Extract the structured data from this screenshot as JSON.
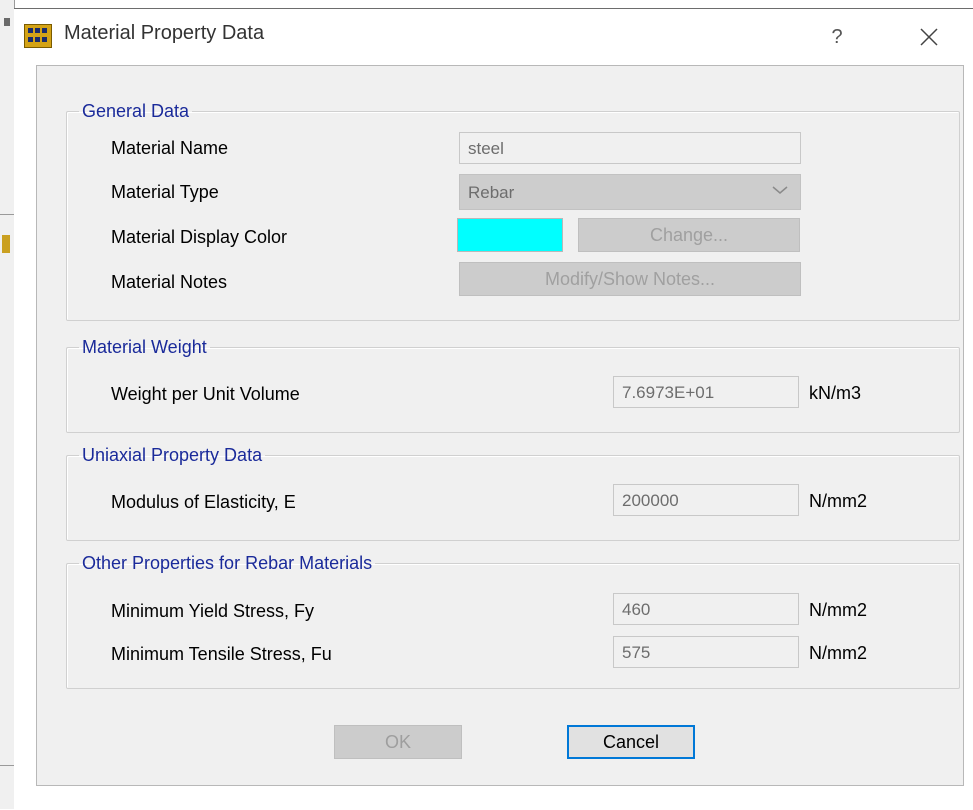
{
  "window": {
    "title": "Material Property Data",
    "help_label": "?",
    "icons": {
      "app": "etabs-app-icon",
      "close": "close-icon"
    }
  },
  "general": {
    "legend": "General Data",
    "name_label": "Material Name",
    "name_value": "steel",
    "type_label": "Material Type",
    "type_value": "Rebar",
    "color_label": "Material Display Color",
    "color_value": "#00ffff",
    "change_label": "Change...",
    "notes_label": "Material Notes",
    "notes_button": "Modify/Show Notes..."
  },
  "weight": {
    "legend": "Material Weight",
    "label": "Weight per Unit Volume",
    "value": "7.6973E+01",
    "unit": "kN/m3"
  },
  "uniaxial": {
    "legend": "Uniaxial Property Data",
    "label": "Modulus of Elasticity,  E",
    "value": "200000",
    "unit": "N/mm2"
  },
  "rebar": {
    "legend": "Other Properties for Rebar Materials",
    "fy_label": "Minimum Yield Stress, Fy",
    "fy_value": "460",
    "fy_unit": "N/mm2",
    "fu_label": "Minimum Tensile Stress, Fu",
    "fu_value": "575",
    "fu_unit": "N/mm2"
  },
  "buttons": {
    "ok": "OK",
    "cancel": "Cancel"
  },
  "colors": {
    "legend": "#1a2a9a",
    "focus": "#0078d7",
    "swatch": "#00ffff"
  }
}
